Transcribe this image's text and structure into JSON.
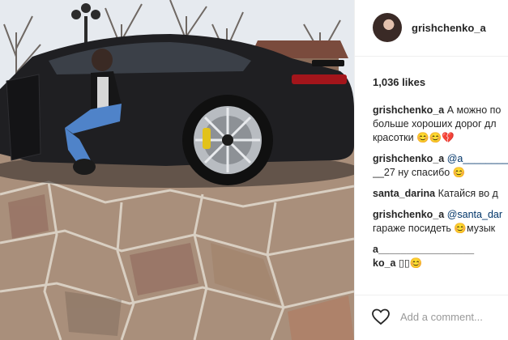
{
  "post": {
    "username": "grishchenko_a",
    "likes": "1,036 likes",
    "add_comment_placeholder": "Add a comment..."
  },
  "comments": [
    {
      "user": "grishchenko_a",
      "text": "А можно по",
      "lines": [
        "больше хороших дорог дл",
        "красотки 😊😊💔"
      ]
    },
    {
      "user": "grishchenko_a",
      "mention": "@a________________",
      "lines": [
        "__27 ну спасибо 😊"
      ]
    },
    {
      "user": "santa_darina",
      "text": "Катайся во д",
      "lines": []
    },
    {
      "user": "grishchenko_a",
      "mention": "@santa_dar",
      "lines": [
        "гараже посидеть 😊музык"
      ]
    },
    {
      "user": "a_________________",
      "text": "",
      "lines": []
    },
    {
      "user": "ko_a",
      "text": "▯▯😊",
      "lines": []
    }
  ],
  "icons": {
    "like": "heart-icon",
    "avatar": "avatar"
  },
  "colors": {
    "link": "#003569",
    "text": "#262626",
    "placeholder": "#999999"
  }
}
